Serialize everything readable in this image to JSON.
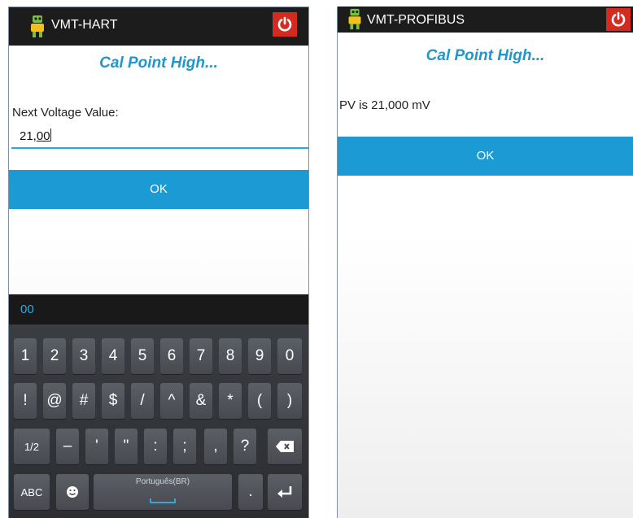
{
  "left": {
    "app_title": "VMT-HART",
    "screen_title": "Cal Point High...",
    "field_label": "Next Voltage Value:",
    "input_value_prefix": "21,",
    "input_value_suffix": "00",
    "ok_label": "OK",
    "suggestion": "00",
    "keyboard": {
      "row1": [
        "1",
        "2",
        "3",
        "4",
        "5",
        "6",
        "7",
        "8",
        "9",
        "0"
      ],
      "row2": [
        "!",
        "@",
        "#",
        "$",
        "/",
        "^",
        "&",
        "*",
        "(",
        ")"
      ],
      "row3": [
        "1/2",
        "–",
        "'",
        "\"",
        ":",
        ";",
        ",",
        "?"
      ],
      "abc_label": "ABC",
      "space_label": "Português(BR)",
      "period_label": "."
    }
  },
  "right": {
    "app_title": "VMT-PROFIBUS",
    "screen_title": "Cal Point High...",
    "message": "PV is 21,000 mV",
    "ok_label": "OK"
  },
  "colors": {
    "accent": "#1b9ad3",
    "title_blue": "#2196c9",
    "power_red": "#d42b20",
    "titlebar": "#1c1c1c"
  },
  "icons": {
    "app": "robot-icon",
    "power": "power-icon",
    "backspace": "backspace-icon",
    "enter": "enter-icon",
    "emoji": "emoji-icon"
  }
}
